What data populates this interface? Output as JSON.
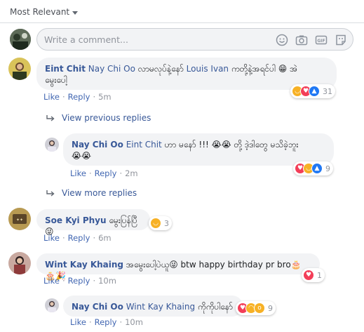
{
  "sort": {
    "label": "Most Relevant"
  },
  "composer": {
    "placeholder": "Write a comment..."
  },
  "comments": [
    {
      "author": "Eint Chit",
      "tag": "Nay Chi Oo",
      "text_a": " လာမလုပ်နဲ့နော် ",
      "tag2": "Louis Ivan",
      "text_b": " ကတို့နဲ့အရင်ပါ 😁 အဲ ",
      "text_c": "မွေးပေါ့",
      "like": "Like",
      "reply": "Reply",
      "time": "5m",
      "reaction_count": "31"
    },
    {
      "author": "Nay Chi Oo",
      "tag": "Eint Chit",
      "text_a": " ဟာ မနော် !!! 😭😭 တို့ ဒဲ့ဒါတွေ မသိခဲ့ဘူး",
      "text_b": "😭😭",
      "like": "Like",
      "reply": "Reply",
      "time": "2m",
      "reaction_count": "9"
    },
    {
      "author": "Soe Kyi Phyu",
      "text_a": " မွေးပြန်ပြီ😜",
      "like": "Like",
      "reply": "Reply",
      "time": "6m",
      "reaction_count": "3"
    },
    {
      "author": "Wint Kay Khaing",
      "text_a": " အမွေးပေါ့ပဲယူ😜 btw happy birthday pr bro🎂🎂🎉",
      "like": "Like",
      "reply": "Reply",
      "time": "10m",
      "reaction_count": "1"
    },
    {
      "author": "Nay Chi Oo",
      "tag": "Wint Kay Khaing",
      "text_a": " ကိုကိုပါနော်",
      "like": "Like",
      "reply": "Reply",
      "time": "10m",
      "reaction_count": "9"
    }
  ],
  "view_previous": "View previous replies",
  "view_more": "View more replies",
  "icons": {
    "emoji": "emoji-icon",
    "camera": "camera-icon",
    "gif": "gif-icon",
    "sticker": "sticker-icon",
    "reply_arrow": "reply-arrow-icon"
  },
  "colors": {
    "link": "#385898",
    "action": "#4267b2",
    "bubble": "#f2f3f5",
    "like": "#2078f4",
    "love": "#f33e58",
    "haha": "#f7b125"
  }
}
